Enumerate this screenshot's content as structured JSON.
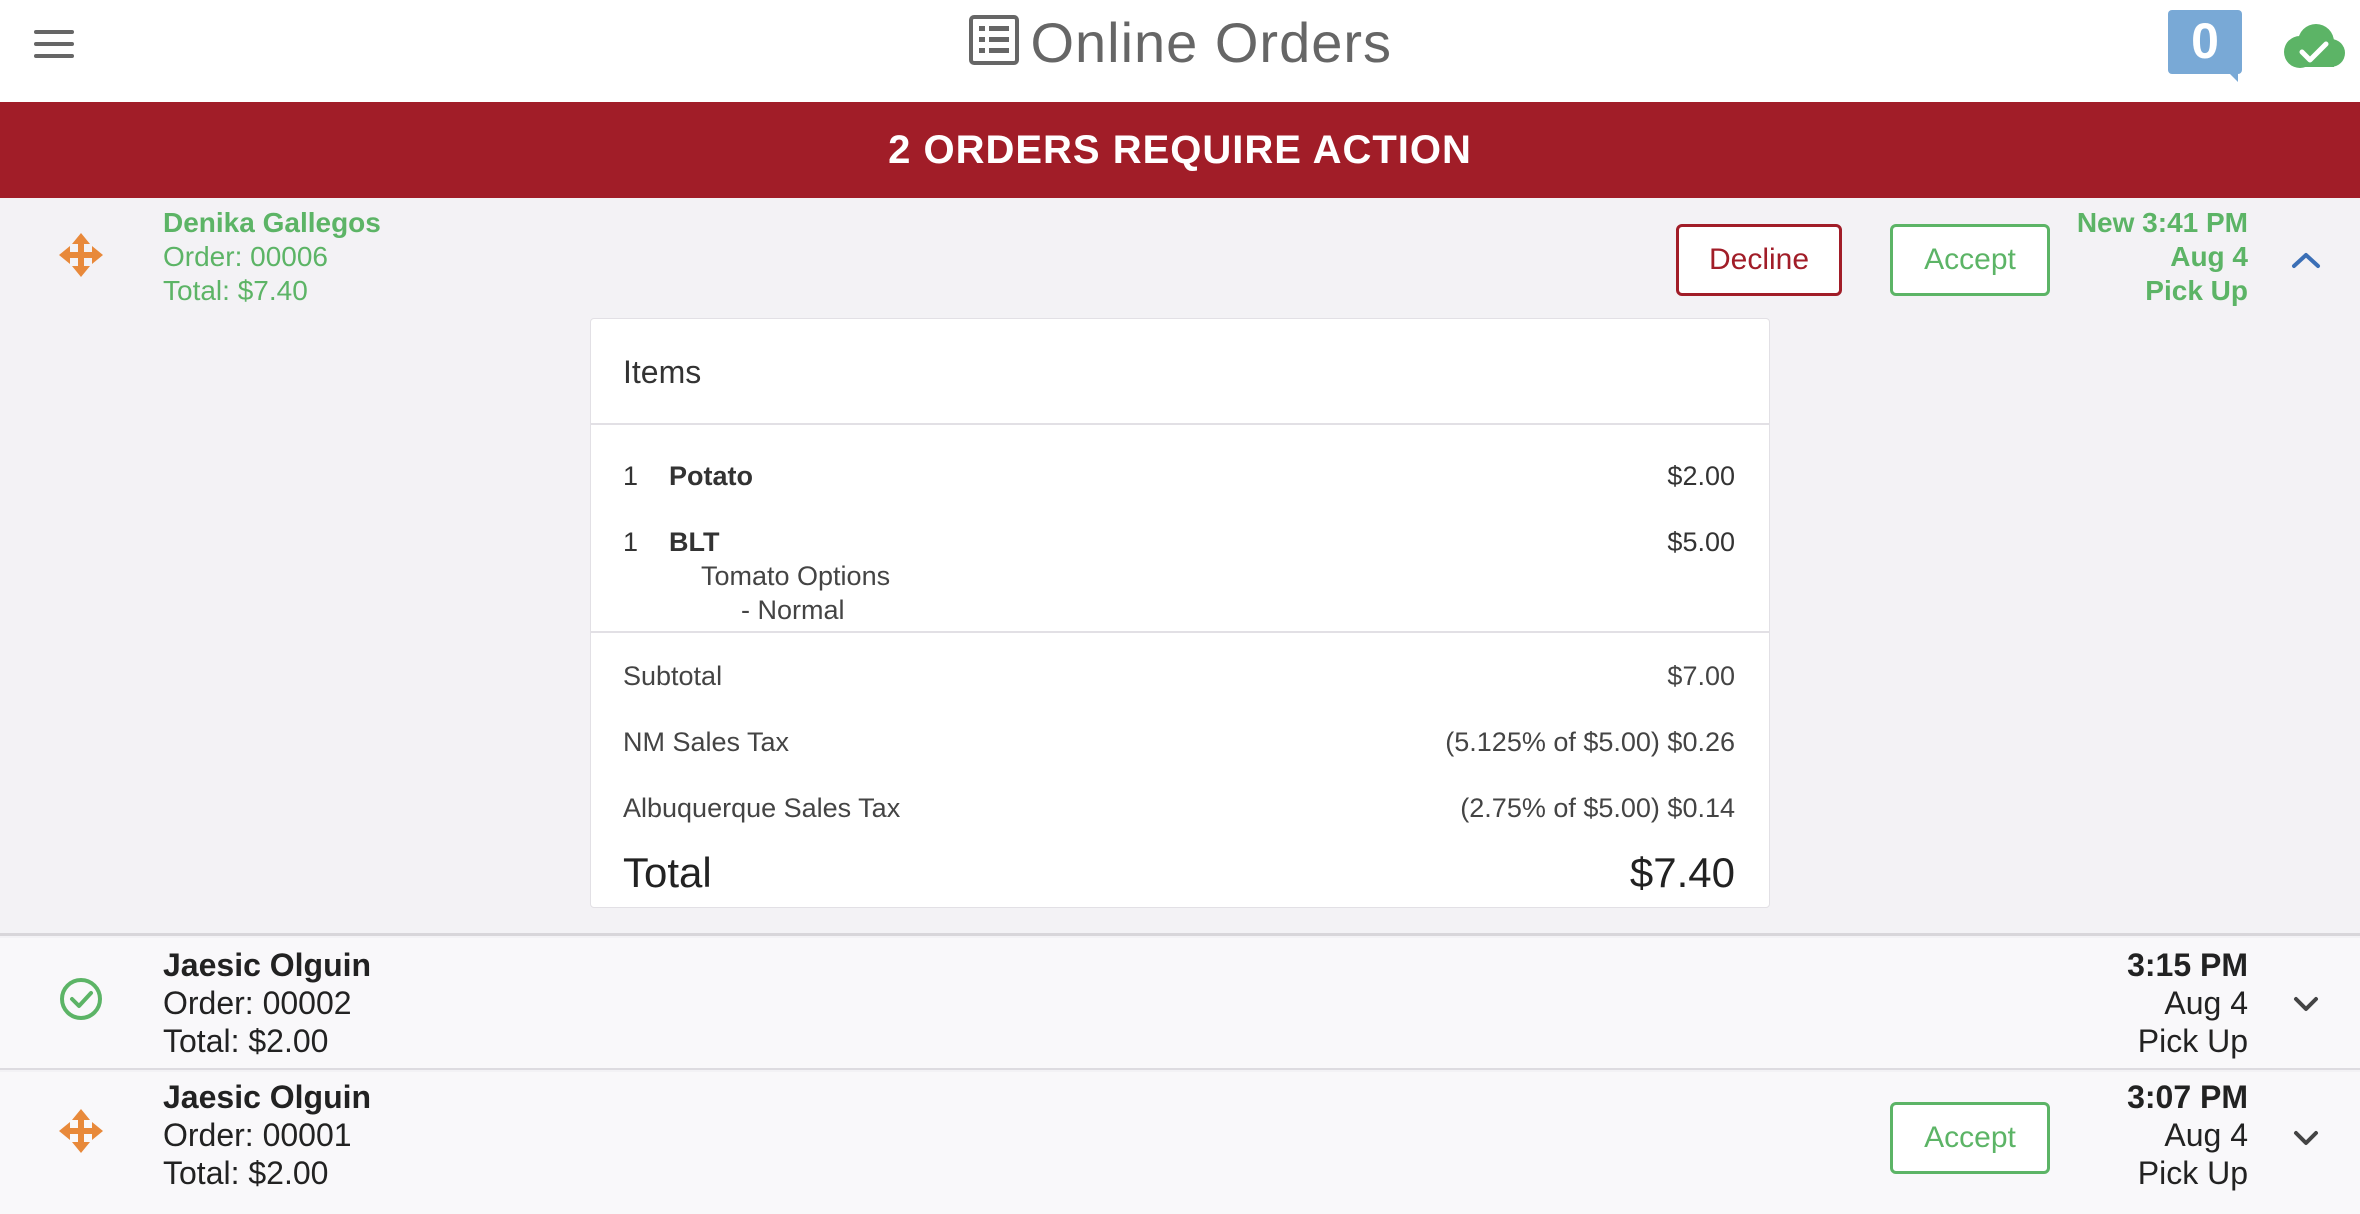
{
  "header": {
    "title": "Online Orders",
    "notification_count": "0",
    "icons": {
      "menu": "hamburger-menu-icon",
      "title": "order-list-icon",
      "status": "cloud-check-icon"
    }
  },
  "banner": {
    "text": "2 ORDERS REQUIRE ACTION"
  },
  "colors": {
    "banner_red": "#a11d28",
    "green": "#5cb466",
    "badge_blue": "#79a9d6",
    "move_orange": "#e8893a"
  },
  "orders": [
    {
      "name": "Denika Gallegos",
      "order": "Order: 00006",
      "total": "Total: $7.40",
      "status": "New 3:41 PM",
      "date": "Aug 4",
      "type": "Pick Up",
      "decline_label": "Decline",
      "accept_label": "Accept",
      "expanded": true,
      "details": {
        "heading": "Items",
        "items": [
          {
            "qty": "1",
            "name": "Potato",
            "price": "$2.00"
          },
          {
            "qty": "1",
            "name": "BLT",
            "price": "$5.00",
            "modifier": "Tomato Options",
            "option": "- Normal"
          }
        ],
        "subtotal_label": "Subtotal",
        "subtotal": "$7.00",
        "taxes": [
          {
            "label": "NM Sales Tax",
            "value": "(5.125% of $5.00) $0.26"
          },
          {
            "label": "Albuquerque Sales Tax",
            "value": "(2.75% of $5.00) $0.14"
          }
        ],
        "total_label": "Total",
        "total": "$7.40"
      }
    },
    {
      "name": "Jaesic Olguin",
      "order": "Order: 00002",
      "total": "Total: $2.00",
      "time": "3:15 PM",
      "date": "Aug 4",
      "type": "Pick Up",
      "accepted": true
    },
    {
      "name": "Jaesic Olguin",
      "order": "Order: 00001",
      "total": "Total: $2.00",
      "time": "3:07 PM",
      "date": "Aug 4",
      "type": "Pick Up",
      "accept_label": "Accept"
    }
  ]
}
